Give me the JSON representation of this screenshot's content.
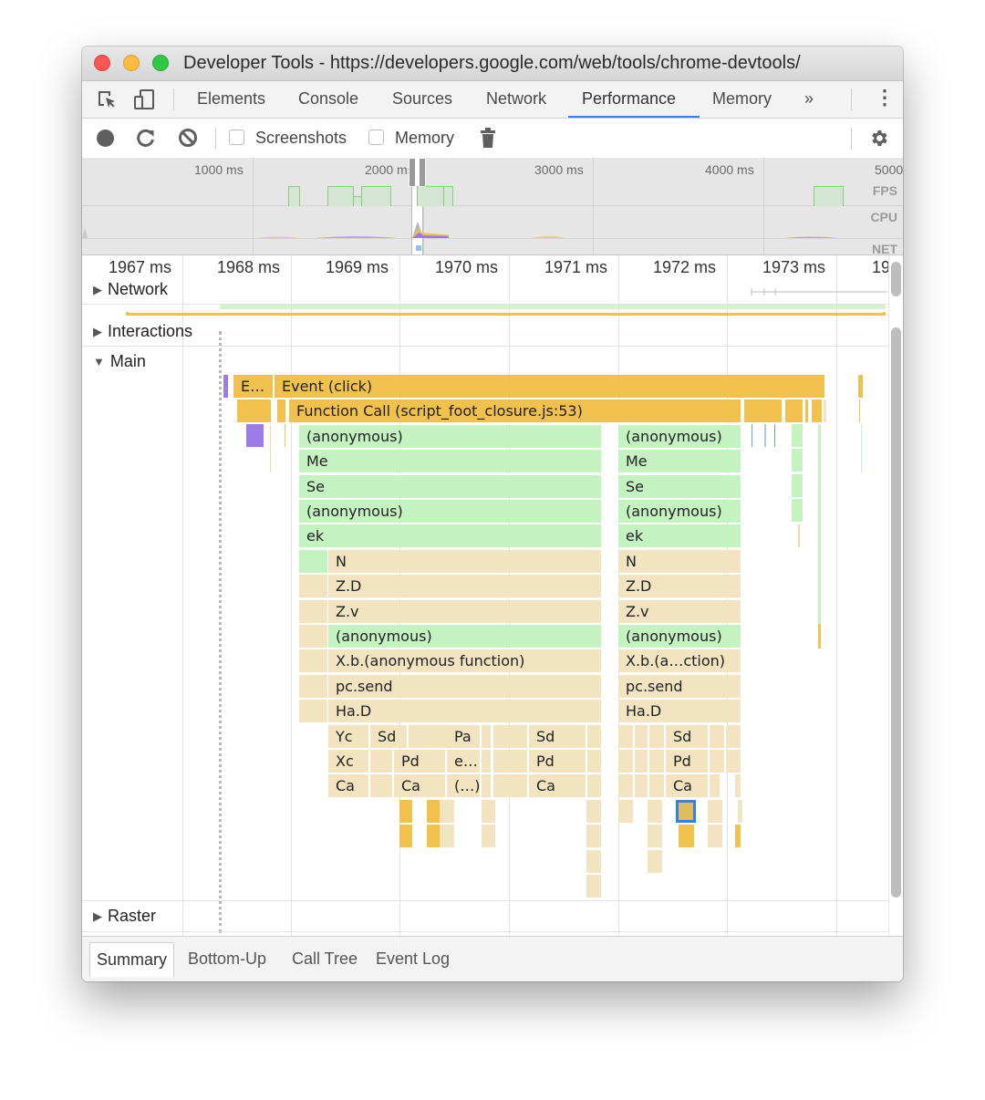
{
  "window": {
    "title": "Developer Tools - https://developers.google.com/web/tools/chrome-devtools/"
  },
  "tabs": {
    "items": [
      {
        "label": "Elements"
      },
      {
        "label": "Console"
      },
      {
        "label": "Sources"
      },
      {
        "label": "Network"
      },
      {
        "label": "Performance",
        "active": true
      },
      {
        "label": "Memory"
      }
    ],
    "more": "»",
    "kebab": "⋮"
  },
  "toolbar": {
    "screenshots_label": "Screenshots",
    "screenshots_checked": false,
    "memory_label": "Memory",
    "memory_checked": false
  },
  "overview": {
    "ticks": [
      "1000 ms",
      "2000 ms",
      "3000 ms",
      "4000 ms",
      "5000"
    ],
    "lanes": [
      "FPS",
      "CPU",
      "NET"
    ]
  },
  "ruler": {
    "ticks": [
      "1967 ms",
      "1968 ms",
      "1969 ms",
      "1970 ms",
      "1971 ms",
      "1972 ms",
      "1973 ms",
      "19"
    ]
  },
  "tracks": {
    "network": "Network",
    "interactions": "Interactions",
    "main": "Main",
    "raster": "Raster"
  },
  "flame": {
    "row0": {
      "e_short": "E…",
      "event_click": "Event (click)"
    },
    "row1": {
      "function_call": "Function Call (script_foot_closure.js:53)"
    },
    "left": [
      "(anonymous)",
      "Me",
      "Se",
      "(anonymous)",
      "ek",
      "N",
      "Z.D",
      "Z.v",
      "(anonymous)",
      "X.b.(anonymous function)",
      "pc.send",
      "Ha.D"
    ],
    "right": [
      "(anonymous)",
      "Me",
      "Se",
      "(anonymous)",
      "ek",
      "N",
      "Z.D",
      "Z.v",
      "(anonymous)",
      "X.b.(a…ction)",
      "pc.send",
      "Ha.D"
    ],
    "leaf_left": {
      "row12": [
        "Yc",
        "Sd",
        "Pa",
        "Sd"
      ],
      "row13": [
        "Xc",
        "Pd",
        "e…",
        "Pd"
      ],
      "row14": [
        "Ca",
        "Ca",
        "(…)",
        "Ca"
      ]
    },
    "leaf_right": {
      "row12": [
        "Sd"
      ],
      "row13": [
        "Pd"
      ],
      "row14": [
        "Ca"
      ]
    }
  },
  "bottom_tabs": [
    {
      "label": "Summary",
      "active": true
    },
    {
      "label": "Bottom-Up"
    },
    {
      "label": "Call Tree"
    },
    {
      "label": "Event Log"
    }
  ],
  "colors": {
    "accent": "#3b7de8",
    "scripting": "#f0c24d",
    "js_frame_green": "#c4f2c0",
    "js_frame_tan": "#f2e4c0",
    "rendering": "#9b7be8"
  }
}
